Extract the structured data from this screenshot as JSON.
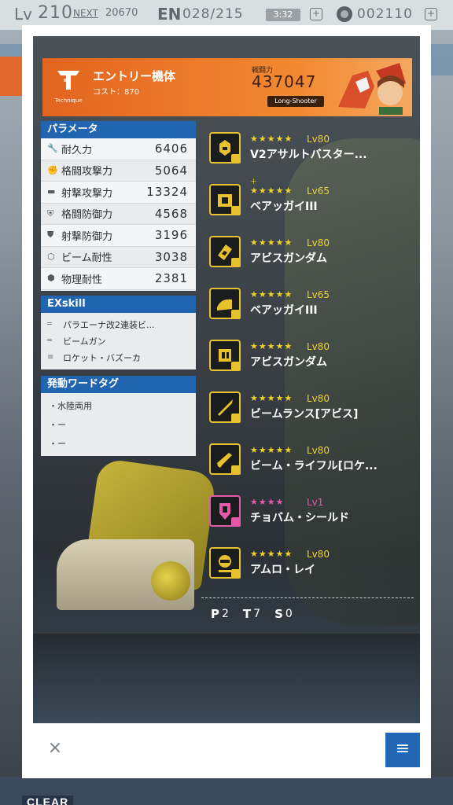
{
  "status_bar": {
    "lv_prefix": "Lv",
    "lv_value": "210",
    "next_label": "NEXT",
    "next_value": "20670",
    "en_label": "EN",
    "en_value": "028/215",
    "timer": "3:32",
    "gem_value": "002110"
  },
  "entry": {
    "emblem_label": "Technique",
    "title": "エントリー機体",
    "cost": "コスト：870",
    "power_label": "戦闘力",
    "power_value": "437047",
    "role": "Long-Shooter"
  },
  "parameters": {
    "header": "パラメータ",
    "rows": [
      {
        "icon": "wrench-icon",
        "name": "耐久力",
        "value": "6406"
      },
      {
        "icon": "fist-icon",
        "name": "格闘攻撃力",
        "value": "5064"
      },
      {
        "icon": "gun-icon",
        "name": "射撃攻撃力",
        "value": "13324"
      },
      {
        "icon": "shield-icon",
        "name": "格闘防御力",
        "value": "4568"
      },
      {
        "icon": "shield-gun-icon",
        "name": "射撃防御力",
        "value": "3196"
      },
      {
        "icon": "beam-resist-icon",
        "name": "ビーム耐性",
        "value": "3038"
      },
      {
        "icon": "physical-resist-icon",
        "name": "物理耐性",
        "value": "2381"
      }
    ]
  },
  "exskill": {
    "header": "EXskill",
    "items": [
      "パラエーナ改2連装ビ...",
      "ビームガン",
      "ロケット・バズーカ"
    ]
  },
  "word_tags": {
    "header": "発動ワードタグ",
    "items": [
      "・水陸両用",
      "・ー",
      "・ー"
    ]
  },
  "parts": [
    {
      "stars": "★★★★★",
      "level": "Lv80",
      "name": "V2アサルトバスター...",
      "color": "gold",
      "icon": "head-part-icon",
      "extra": ""
    },
    {
      "stars": "★★★★★",
      "level": "Lv65",
      "name": "ベアッガイIII",
      "color": "gold",
      "icon": "body-part-icon",
      "extra": "＋"
    },
    {
      "stars": "★★★★★",
      "level": "Lv80",
      "name": "アビスガンダム",
      "color": "gold",
      "icon": "arm-part-icon",
      "extra": ""
    },
    {
      "stars": "★★★★★",
      "level": "Lv65",
      "name": "ベアッガイIII",
      "color": "gold",
      "icon": "leg-part-icon",
      "extra": ""
    },
    {
      "stars": "★★★★★",
      "level": "Lv80",
      "name": "アビスガンダム",
      "color": "gold",
      "icon": "backpack-part-icon",
      "extra": ""
    },
    {
      "stars": "★★★★★",
      "level": "Lv80",
      "name": "ビームランス[アビス]",
      "color": "gold",
      "icon": "melee-weapon-icon",
      "extra": ""
    },
    {
      "stars": "★★★★★",
      "level": "Lv80",
      "name": "ビーム・ライフル[ロケ...",
      "color": "gold",
      "icon": "ranged-weapon-icon",
      "extra": ""
    },
    {
      "stars": "★★★★",
      "level": "Lv1",
      "name": "チョバム・シールド",
      "color": "pink",
      "icon": "shield-part-icon",
      "extra": ""
    },
    {
      "stars": "★★★★★",
      "level": "Lv80",
      "name": "アムロ・レイ",
      "color": "gold",
      "icon": "pilot-icon",
      "extra": ""
    }
  ],
  "counts": {
    "p_label": "P",
    "p_value": "2",
    "t_label": "T",
    "t_value": "7",
    "s_label": "S",
    "s_value": "0"
  },
  "footer": {
    "close_glyph": "×",
    "menu_glyph": "≡"
  },
  "background": {
    "clear_label": "CLEAR"
  },
  "colors": {
    "accent_blue": "#2165b0",
    "banner_orange": "#e2641f",
    "rarity_gold": "#f1d22a",
    "rarity_pink": "#e35aa8"
  }
}
